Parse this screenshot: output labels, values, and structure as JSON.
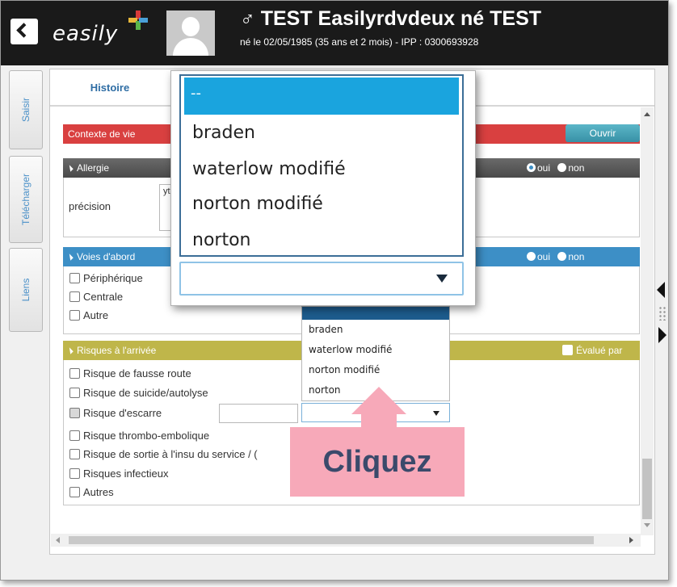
{
  "header": {
    "logo": "easily",
    "patient_name": "♂ TEST Easilyrdvdeux né TEST",
    "patient_info": "né le 02/05/1985 (35 ans et 2 mois) - IPP : 0300693928"
  },
  "side_tabs": [
    "Saisir",
    "Télécharger",
    "Liens"
  ],
  "tabs": {
    "active": "Histoire"
  },
  "sections": {
    "contexte": {
      "label": "Contexte de vie",
      "button": "Ouvrir"
    },
    "allergie": {
      "label": "Allergie",
      "oui": "oui",
      "non": "non",
      "precision_label": "précision",
      "precision_value": "yt"
    },
    "voies": {
      "label": "Voies d'abord",
      "oui": "oui",
      "non": "non",
      "items": [
        "Périphérique",
        "Centrale",
        "Autre"
      ]
    },
    "risques": {
      "label": "Risques à l'arrivée",
      "evalue": "Évalué par",
      "items": [
        "Risque de fausse route",
        "Risque de suicide/autolyse",
        "Risque d'escarre",
        "Risque thrombo-embolique",
        "Risque de sortie à l'insu du service / (",
        "Risques infectieux",
        "Autres"
      ]
    }
  },
  "dropdown": {
    "selected": "--",
    "options": [
      "braden",
      "waterlow modifié",
      "norton modifié",
      "norton"
    ]
  },
  "callout": {
    "text": "Cliquez"
  },
  "colors": {
    "header": "#1a1a1a",
    "contexte_bar": "#d94040",
    "voies_bar": "#3d8fc6",
    "risques_bar": "#bfb64a",
    "selected_option": "#1aa4de",
    "callout": "#f7a9b9"
  }
}
